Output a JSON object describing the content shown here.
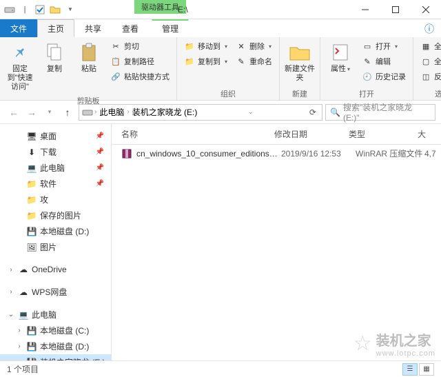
{
  "title_path": "E:\\",
  "context_tab_title": "驱动器工具",
  "tabs": {
    "file": "文件",
    "home": "主页",
    "share": "共享",
    "view": "查看",
    "manage": "管理"
  },
  "ribbon": {
    "pin": "固定到\"快速访问\"",
    "copy": "复制",
    "paste": "粘贴",
    "cut": "剪切",
    "copy_path": "复制路径",
    "paste_shortcut": "粘贴快捷方式",
    "g_clipboard": "剪贴板",
    "move_to": "移动到",
    "copy_to": "复制到",
    "delete": "删除",
    "rename": "重命名",
    "g_organize": "组织",
    "new_folder": "新建文件夹",
    "g_new": "新建",
    "properties": "属性",
    "open": "打开",
    "edit": "编辑",
    "history": "历史记录",
    "g_open": "打开",
    "select_all": "全部选择",
    "select_none": "全部取消",
    "invert": "反向选择",
    "g_select": "选择"
  },
  "breadcrumb": {
    "root": "此电脑",
    "current": "装机之家晓龙 (E:)"
  },
  "search_placeholder": "搜索\"装机之家晓龙 (E:)\"",
  "columns": {
    "name": "名称",
    "date": "修改日期",
    "type": "类型",
    "size": "大"
  },
  "files": [
    {
      "name": "cn_windows_10_consumer_editions_v...",
      "date": "2019/9/16 12:53",
      "type": "WinRAR 压缩文件",
      "size": "4,7"
    }
  ],
  "tree": {
    "desktop": "桌面",
    "downloads": "下载",
    "this_pc": "此电脑",
    "software": "软件",
    "gong": "攻",
    "saved_pics": "保存的图片",
    "local_d": "本地磁盘 (D:)",
    "pictures": "图片",
    "onedrive": "OneDrive",
    "wps": "WPS网盘",
    "this_pc_root": "此电脑",
    "local_c": "本地磁盘 (C:)",
    "local_d2": "本地磁盘 (D:)",
    "drive_e": "装机之家晓龙 (E:)"
  },
  "status_text": "1 个项目",
  "watermark": {
    "name": "装机之家",
    "url": "www.lotpc.com"
  }
}
